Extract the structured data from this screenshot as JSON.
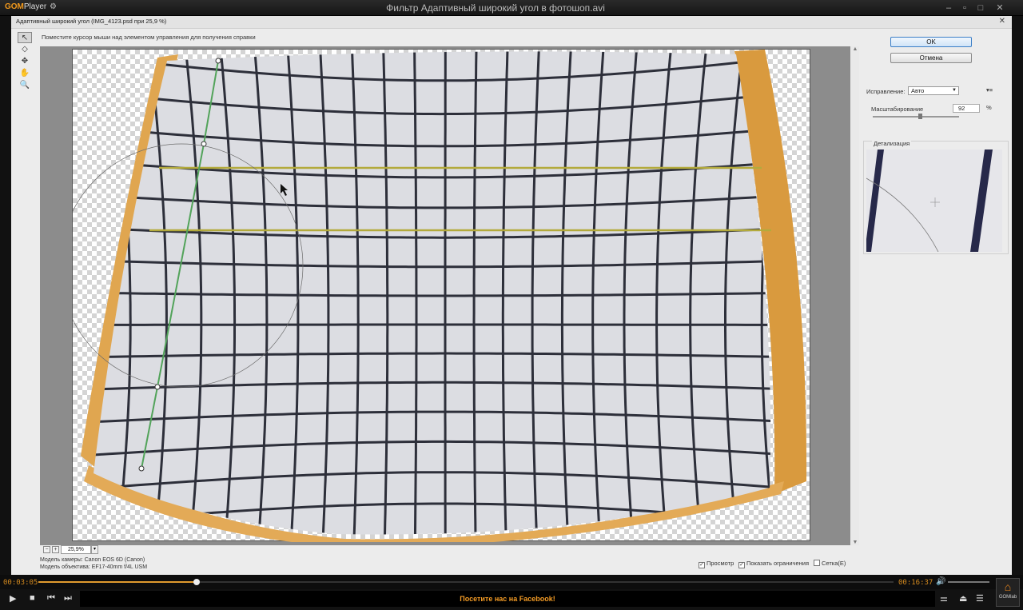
{
  "player": {
    "logo_gom": "GOM",
    "logo_player": "Player",
    "title": "Фильтр Адаптивный широкий угол в фотошоп.avi",
    "time_current": "00:03:05",
    "time_total": "00:16:37",
    "progress_fraction": 0.185,
    "promo": "Посетите нас на Facebook!",
    "gomlab_label": "GOMlab"
  },
  "dialog": {
    "title": "Адаптивный широкий угол (IMG_4123.psd при 25,9 %)",
    "hint": "Поместите курсор мыши над элементом управления для получения справки",
    "ok": "OK",
    "cancel": "Отмена",
    "correction_label": "Исправление:",
    "correction_value": "Авто",
    "scale_label": "Масштабирование",
    "scale_value": "92",
    "scale_unit": "%",
    "scale_fraction": 0.55,
    "detail_label": "Детализация",
    "zoom_value": "25,9%",
    "camera_model": "Модель камеры: Canon EOS 6D (Canon)",
    "lens_model": "Модель объектива: EF17-40mm f/4L USM",
    "preview_label": "Просмотр",
    "preview_checked": true,
    "show_constraints_label": "Показать ограничения",
    "show_constraints_checked": true,
    "grid_label": "Сетка(E)",
    "grid_checked": false
  },
  "colors": {
    "accent": "#e09a2e",
    "constraint_line": "#52a35a",
    "constraint_horizontal": "#b3aa3c",
    "wood_frame": "#e0a650",
    "grid_line": "#2d2f3a"
  }
}
